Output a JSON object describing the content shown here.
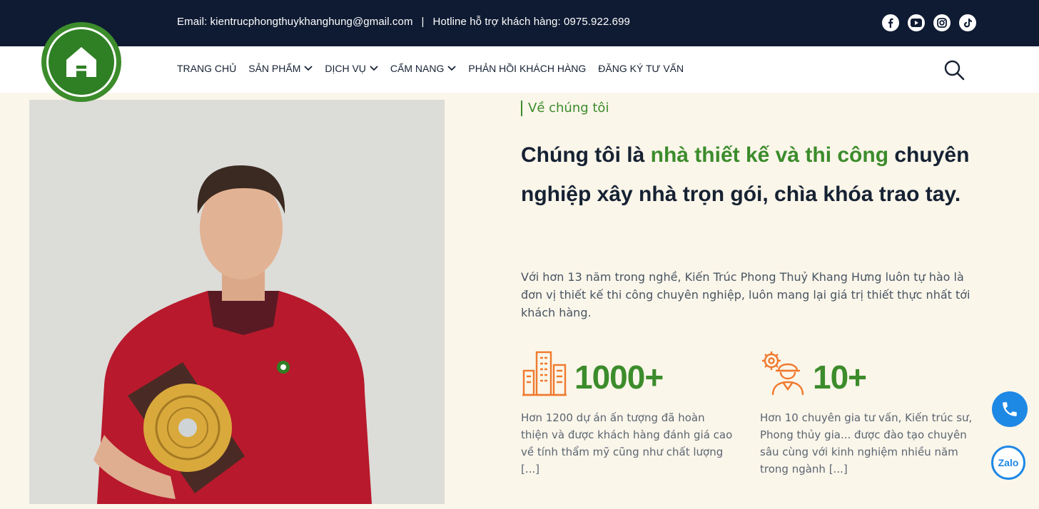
{
  "topbar": {
    "email": "Email: kientrucphongthuykhanghung@gmail.com",
    "separator": "|",
    "hotline": "Hotline hỗ trợ khách hàng: 0975.922.699",
    "social": [
      "facebook-icon",
      "youtube-icon",
      "instagram-icon",
      "tiktok-icon"
    ]
  },
  "nav": {
    "items": [
      {
        "label": "TRANG CHỦ"
      },
      {
        "label": "SẢN PHẨM"
      },
      {
        "label": "DỊCH VỤ"
      },
      {
        "label": "CẨM NANG"
      },
      {
        "label": "PHẢN HỒI KHÁCH HÀNG"
      },
      {
        "label": "ĐĂNG KÝ TƯ VẤN"
      }
    ]
  },
  "about": {
    "tagline": "Về chúng tôi",
    "heading_pre": "Chúng tôi là ",
    "heading_highlight": "nhà thiết kế và thi công",
    "heading_post": " chuyên nghiệp xây nhà trọn gói, chìa khóa trao tay.",
    "intro": "Với hơn 13 năm trong nghề, Kiến Trúc Phong Thuỷ Khang Hưng luôn tự hào là đơn vị thiết kế thi công chuyên nghiệp, luôn mang lại giá trị thiết thực nhất tới khách hàng."
  },
  "stats": [
    {
      "number": "1000+",
      "desc": "Hơn 1200 dự án ấn tượng đã hoàn thiện và được khách hàng đánh giá cao về tính thẩm mỹ cũng như chất lượng [...]"
    },
    {
      "number": "10+",
      "desc": "Hơn 10 chuyên gia tư vấn, Kiến trúc sư, Phong thủy gia... được đào tạo chuyên sâu cùng với kinh nghiệm nhiều năm trong ngành [...]"
    }
  ],
  "floating": {
    "zalo": "Zalo"
  },
  "colors": {
    "navy": "#0f1b33",
    "green": "#3c8c2c",
    "orange": "#f07a2e",
    "blue": "#1e88e5",
    "cream": "#fbf6ea"
  }
}
